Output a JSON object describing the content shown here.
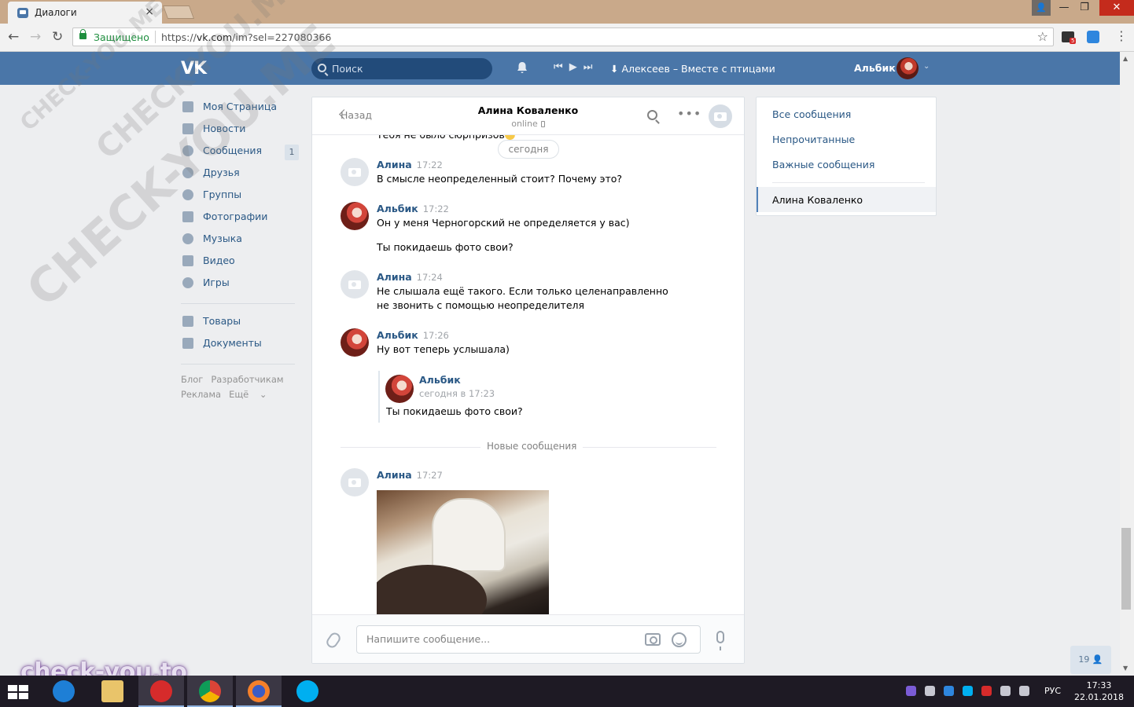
{
  "browser": {
    "tab_title": "Диалоги",
    "tab_close": "×",
    "secure_label": "Защищено",
    "url_prefix": "https://",
    "url_host": "vk.com",
    "url_path": "/im?sel=227080366",
    "extension_badge": "5"
  },
  "window_controls": {
    "user": "👤",
    "minimize": "—",
    "restore": "❐",
    "close": "✕"
  },
  "header": {
    "logo": "VK",
    "search_placeholder": "Поиск",
    "player_track": "Алексеев – Вместе с птицами",
    "user_name": "Альбик"
  },
  "left_menu": {
    "items": [
      {
        "label": "Моя Страница",
        "icon": "home-icon"
      },
      {
        "label": "Новости",
        "icon": "news-icon"
      },
      {
        "label": "Сообщения",
        "icon": "messages-icon",
        "badge": "1"
      },
      {
        "label": "Друзья",
        "icon": "friends-icon"
      },
      {
        "label": "Группы",
        "icon": "groups-icon"
      },
      {
        "label": "Фотографии",
        "icon": "photos-icon"
      },
      {
        "label": "Музыка",
        "icon": "music-icon"
      },
      {
        "label": "Видео",
        "icon": "video-icon"
      },
      {
        "label": "Игры",
        "icon": "games-icon"
      },
      {
        "label": "Товары",
        "icon": "goods-icon"
      },
      {
        "label": "Документы",
        "icon": "documents-icon"
      }
    ],
    "footer": {
      "blog": "Блог",
      "developers": "Разработчикам",
      "ads": "Реклама",
      "more": "Ещё"
    }
  },
  "chat": {
    "back_label": "Назад",
    "peer_name": "Алина Коваленко",
    "peer_status": "online",
    "truncated_text": "Тебя не было сюрпризов",
    "date_pill": "сегодня",
    "messages": [
      {
        "author": "Алина",
        "time": "17:22",
        "text": "В смысле неопределенный стоит? Почему это?"
      },
      {
        "author": "Альбик",
        "time": "17:22",
        "text": "Он у меня Черногорский не определяется у вас)",
        "text2": "Ты покидаешь фото свои?"
      },
      {
        "author": "Алина",
        "time": "17:24",
        "text": "Не слышала ещё такого. Если только целенаправленно не звонить с помощью неопределителя"
      },
      {
        "author": "Альбик",
        "time": "17:26",
        "text": "Ну вот теперь услышала)"
      }
    ],
    "forwarded": {
      "author": "Альбик",
      "date": "сегодня в 17:23",
      "text": "Ты покидаешь фото свои?"
    },
    "new_messages_label": "Новые сообщения",
    "last_message": {
      "author": "Алина",
      "time": "17:27"
    },
    "input_placeholder": "Напишите сообщение..."
  },
  "right_menu": {
    "all": "Все сообщения",
    "unread": "Непрочитанные",
    "important": "Важные сообщения",
    "active_dialog": "Алина Коваленко"
  },
  "online_count": "19",
  "watermarks": {
    "diagonal": "CHECK-YOU.ME",
    "bottom": "check-you.to"
  },
  "taskbar": {
    "lang": "РУС",
    "time": "17:33",
    "date": "22.01.2018"
  },
  "colors": {
    "vk_blue": "#4a76a8",
    "link": "#2a5885",
    "background": "#edeef0"
  }
}
